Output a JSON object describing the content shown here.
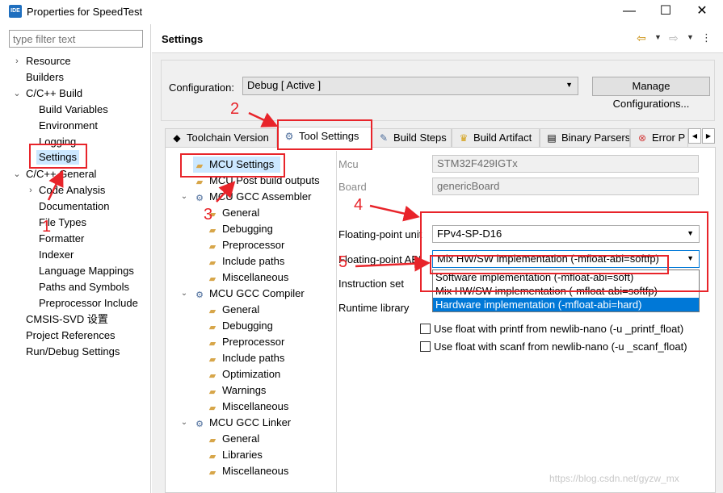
{
  "window": {
    "icon_text": "IDE",
    "title": "Properties for SpeedTest",
    "minimize": "—",
    "maximize": "☐",
    "close": "✕"
  },
  "filter": {
    "placeholder": "type filter text"
  },
  "nav": {
    "resource": "Resource",
    "builders": "Builders",
    "cpp_build": "C/C++ Build",
    "build_variables": "Build Variables",
    "environment": "Environment",
    "logging": "Logging",
    "settings": "Settings",
    "cpp_general": "C/C++ General",
    "code_analysis": "Code Analysis",
    "documentation": "Documentation",
    "file_types": "File Types",
    "formatter": "Formatter",
    "indexer": "Indexer",
    "language_mappings": "Language Mappings",
    "paths_symbols": "Paths and Symbols",
    "preprocessor_include": "Preprocessor Include",
    "cmsis_svd": "CMSIS-SVD 设置",
    "project_references": "Project References",
    "run_debug": "Run/Debug Settings"
  },
  "header": {
    "title": "Settings"
  },
  "config": {
    "label": "Configuration:",
    "value": "Debug  [ Active ]",
    "manage_button": "Manage Configurations..."
  },
  "tabs": {
    "toolchain": "Toolchain  Version",
    "tool_settings": "Tool Settings",
    "build_steps": "Build Steps",
    "build_artifact": "Build Artifact",
    "binary_parsers": "Binary Parsers",
    "error_parsers": "Error P"
  },
  "tree": {
    "mcu_settings": "MCU Settings",
    "mcu_post_build": "MCU Post build outputs",
    "assembler": "MCU GCC Assembler",
    "asm_general": "General",
    "asm_debugging": "Debugging",
    "asm_preprocessor": "Preprocessor",
    "asm_include": "Include paths",
    "asm_misc": "Miscellaneous",
    "compiler": "MCU GCC Compiler",
    "cc_general": "General",
    "cc_debugging": "Debugging",
    "cc_preprocessor": "Preprocessor",
    "cc_include": "Include paths",
    "cc_optimization": "Optimization",
    "cc_warnings": "Warnings",
    "cc_misc": "Miscellaneous",
    "linker": "MCU GCC Linker",
    "ld_general": "General",
    "ld_libraries": "Libraries",
    "ld_misc": "Miscellaneous"
  },
  "form": {
    "mcu_label": "Mcu",
    "mcu_value": "STM32F429IGTx",
    "board_label": "Board",
    "board_value": "genericBoard",
    "fpu_label": "Floating-point unit",
    "fpu_value": "FPv4-SP-D16",
    "fpabi_label": "Floating-point ABI",
    "fpabi_value": "Mix HW/SW implementation (-mfloat-abi=softfp)",
    "instruction_label": "Instruction set",
    "runtime_label": "Runtime library",
    "options": [
      "Software implementation (-mfloat-abi=soft)",
      "Mix HW/SW implementation (-mfloat-abi=softfp)",
      "Hardware implementation (-mfloat-abi=hard)"
    ],
    "printf_float": "Use float with printf from newlib-nano (-u _printf_float)",
    "scanf_float": "Use float with scanf from newlib-nano (-u _scanf_float)"
  },
  "annotations": [
    "1",
    "2",
    "3",
    "4",
    "5"
  ],
  "watermark": "https://blog.csdn.net/gyzw_mx",
  "accent": "#e8242a"
}
